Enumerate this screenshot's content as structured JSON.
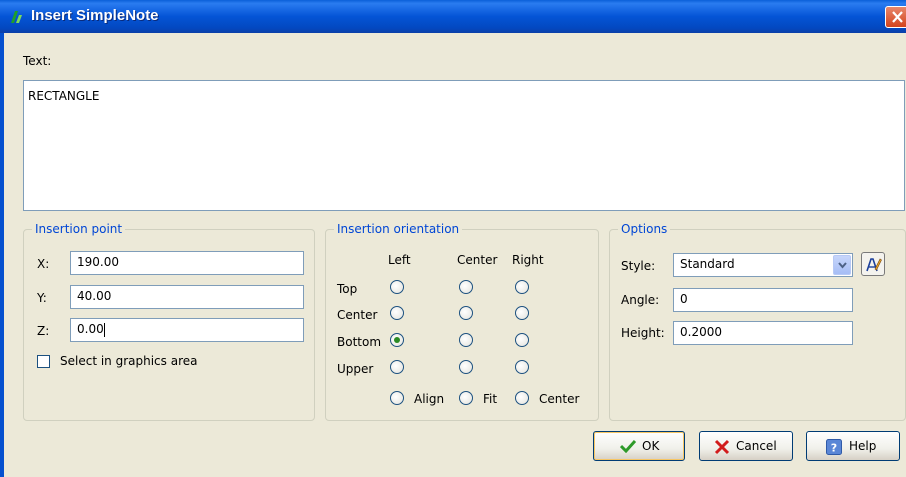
{
  "window": {
    "title": "Insert SimpleNote",
    "icon": "simplenote-app-icon",
    "close_icon": "close-icon"
  },
  "text": {
    "label": "Text:",
    "value": "RECTANGLE"
  },
  "insertion_point": {
    "title": "Insertion point",
    "x_label": "X:",
    "x_value": "190.00",
    "y_label": "Y:",
    "y_value": "40.00",
    "z_label": "Z:",
    "z_value": "0.00",
    "select_label": "Select in graphics area",
    "select_checked": false
  },
  "orientation": {
    "title": "Insertion orientation",
    "columns": [
      "Left",
      "Center",
      "Right"
    ],
    "rows": [
      "Top",
      "Center",
      "Bottom",
      "Upper"
    ],
    "selected": "Bottom-Left",
    "extra": [
      "Align",
      "Fit",
      "Center"
    ]
  },
  "options": {
    "title": "Options",
    "style_label": "Style:",
    "style_value": "Standard",
    "angle_label": "Angle:",
    "angle_value": "0",
    "height_label": "Height:",
    "height_value": "0.2000",
    "style_edit_icon": "text-style-edit-icon"
  },
  "buttons": {
    "ok": "OK",
    "cancel": "Cancel",
    "help": "Help"
  },
  "colors": {
    "titlebar": "#0454d6",
    "group_title": "#0046d5",
    "dialog_bg": "#ece9d8",
    "ok_check": "#2e9a2a",
    "cancel_x": "#d21c1c"
  }
}
